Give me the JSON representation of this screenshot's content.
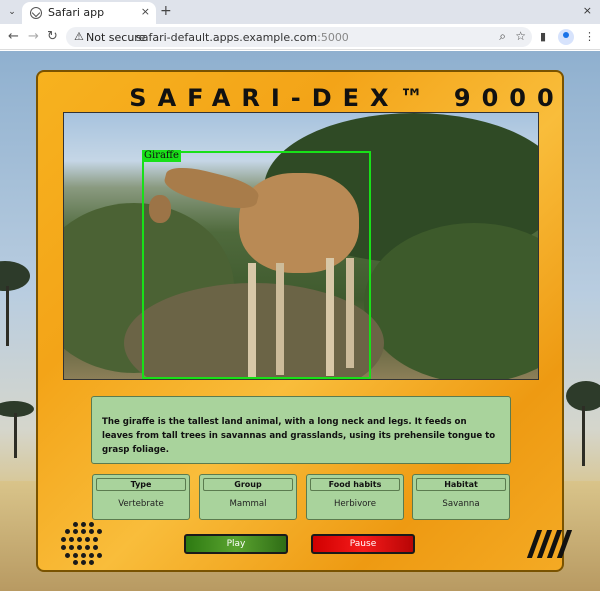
{
  "browser": {
    "tab_title": "Safari app",
    "tab_close": "×",
    "new_tab": "+",
    "window_close": "×",
    "security_label": "Not secure",
    "url_host": "safari-default.apps.example.com",
    "url_port": ":5000",
    "back": "←",
    "forward": "→",
    "reload": "↻"
  },
  "app": {
    "title": "SAFARI-DEX™ 9000",
    "detection": {
      "label": "Giraffe"
    },
    "description": "The giraffe is the tallest land animal, with a long neck and legs. It feeds on leaves from tall trees in savannas and grasslands, using its prehensile tongue to grasp foliage.",
    "info": [
      {
        "header": "Type",
        "value": "Vertebrate"
      },
      {
        "header": "Group",
        "value": "Mammal"
      },
      {
        "header": "Food habits",
        "value": "Herbivore"
      },
      {
        "header": "Habitat",
        "value": "Savanna"
      }
    ],
    "play_label": "Play",
    "pause_label": "Pause"
  },
  "colors": {
    "panel": "#f3a418",
    "info_green": "#a9d39c",
    "bbox": "#18e018",
    "play": "#3f8a1f",
    "pause": "#e50f0f"
  },
  "icons": {
    "speaker": "speaker-grille-icon",
    "slashes": "tally-slashes-icon"
  }
}
